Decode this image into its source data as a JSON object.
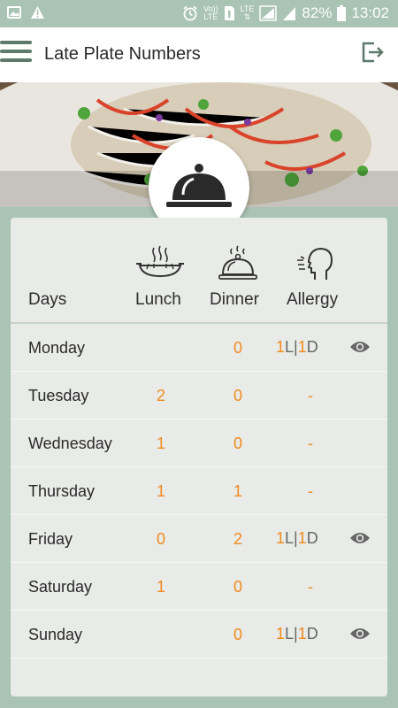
{
  "status_bar": {
    "battery": "82%",
    "time": "13:02",
    "volte_label_1": "Vo))",
    "volte_label_2": "LTE",
    "lte_label": "LTE"
  },
  "app_bar": {
    "title": "Late Plate Numbers"
  },
  "table": {
    "headers": {
      "days": "Days",
      "lunch": "Lunch",
      "dinner": "Dinner",
      "allergy": "Allergy"
    },
    "rows": [
      {
        "day": "Monday",
        "lunch": "",
        "dinner": "0",
        "allergy": {
          "l": "1",
          "l_suffix": "L",
          "sep": "|",
          "d": "1",
          "d_suffix": "D"
        },
        "eye": true
      },
      {
        "day": "Tuesday",
        "lunch": "2",
        "dinner": "0",
        "allergy_dash": "-"
      },
      {
        "day": "Wednesday",
        "lunch": "1",
        "dinner": "0",
        "allergy_dash": "-"
      },
      {
        "day": "Thursday",
        "lunch": "1",
        "dinner": "1",
        "allergy_dash": "-"
      },
      {
        "day": "Friday",
        "lunch": "0",
        "dinner": "2",
        "allergy": {
          "l": "1",
          "l_suffix": "L",
          "sep": "|",
          "d": "1",
          "d_suffix": "D"
        },
        "eye": true
      },
      {
        "day": "Saturday",
        "lunch": "1",
        "dinner": "0",
        "allergy_dash": "-"
      },
      {
        "day": "Sunday",
        "lunch": "",
        "dinner": "0",
        "allergy": {
          "l": "1",
          "l_suffix": "L",
          "sep": "|",
          "d": "1",
          "d_suffix": "D"
        },
        "eye": true
      }
    ]
  },
  "colors": {
    "accent": "#f08a1e",
    "background": "#a9c3b5",
    "card": "#e8ebe7",
    "primary": "#5d7a6c"
  },
  "icons": [
    "image-icon",
    "warning-icon",
    "alarm-icon",
    "sim-icon",
    "signal-icon",
    "battery-icon",
    "menu-icon",
    "logout-icon",
    "cloche-icon",
    "lunch-bowl-icon",
    "dinner-cloche-icon",
    "allergy-head-icon",
    "eye-icon"
  ]
}
